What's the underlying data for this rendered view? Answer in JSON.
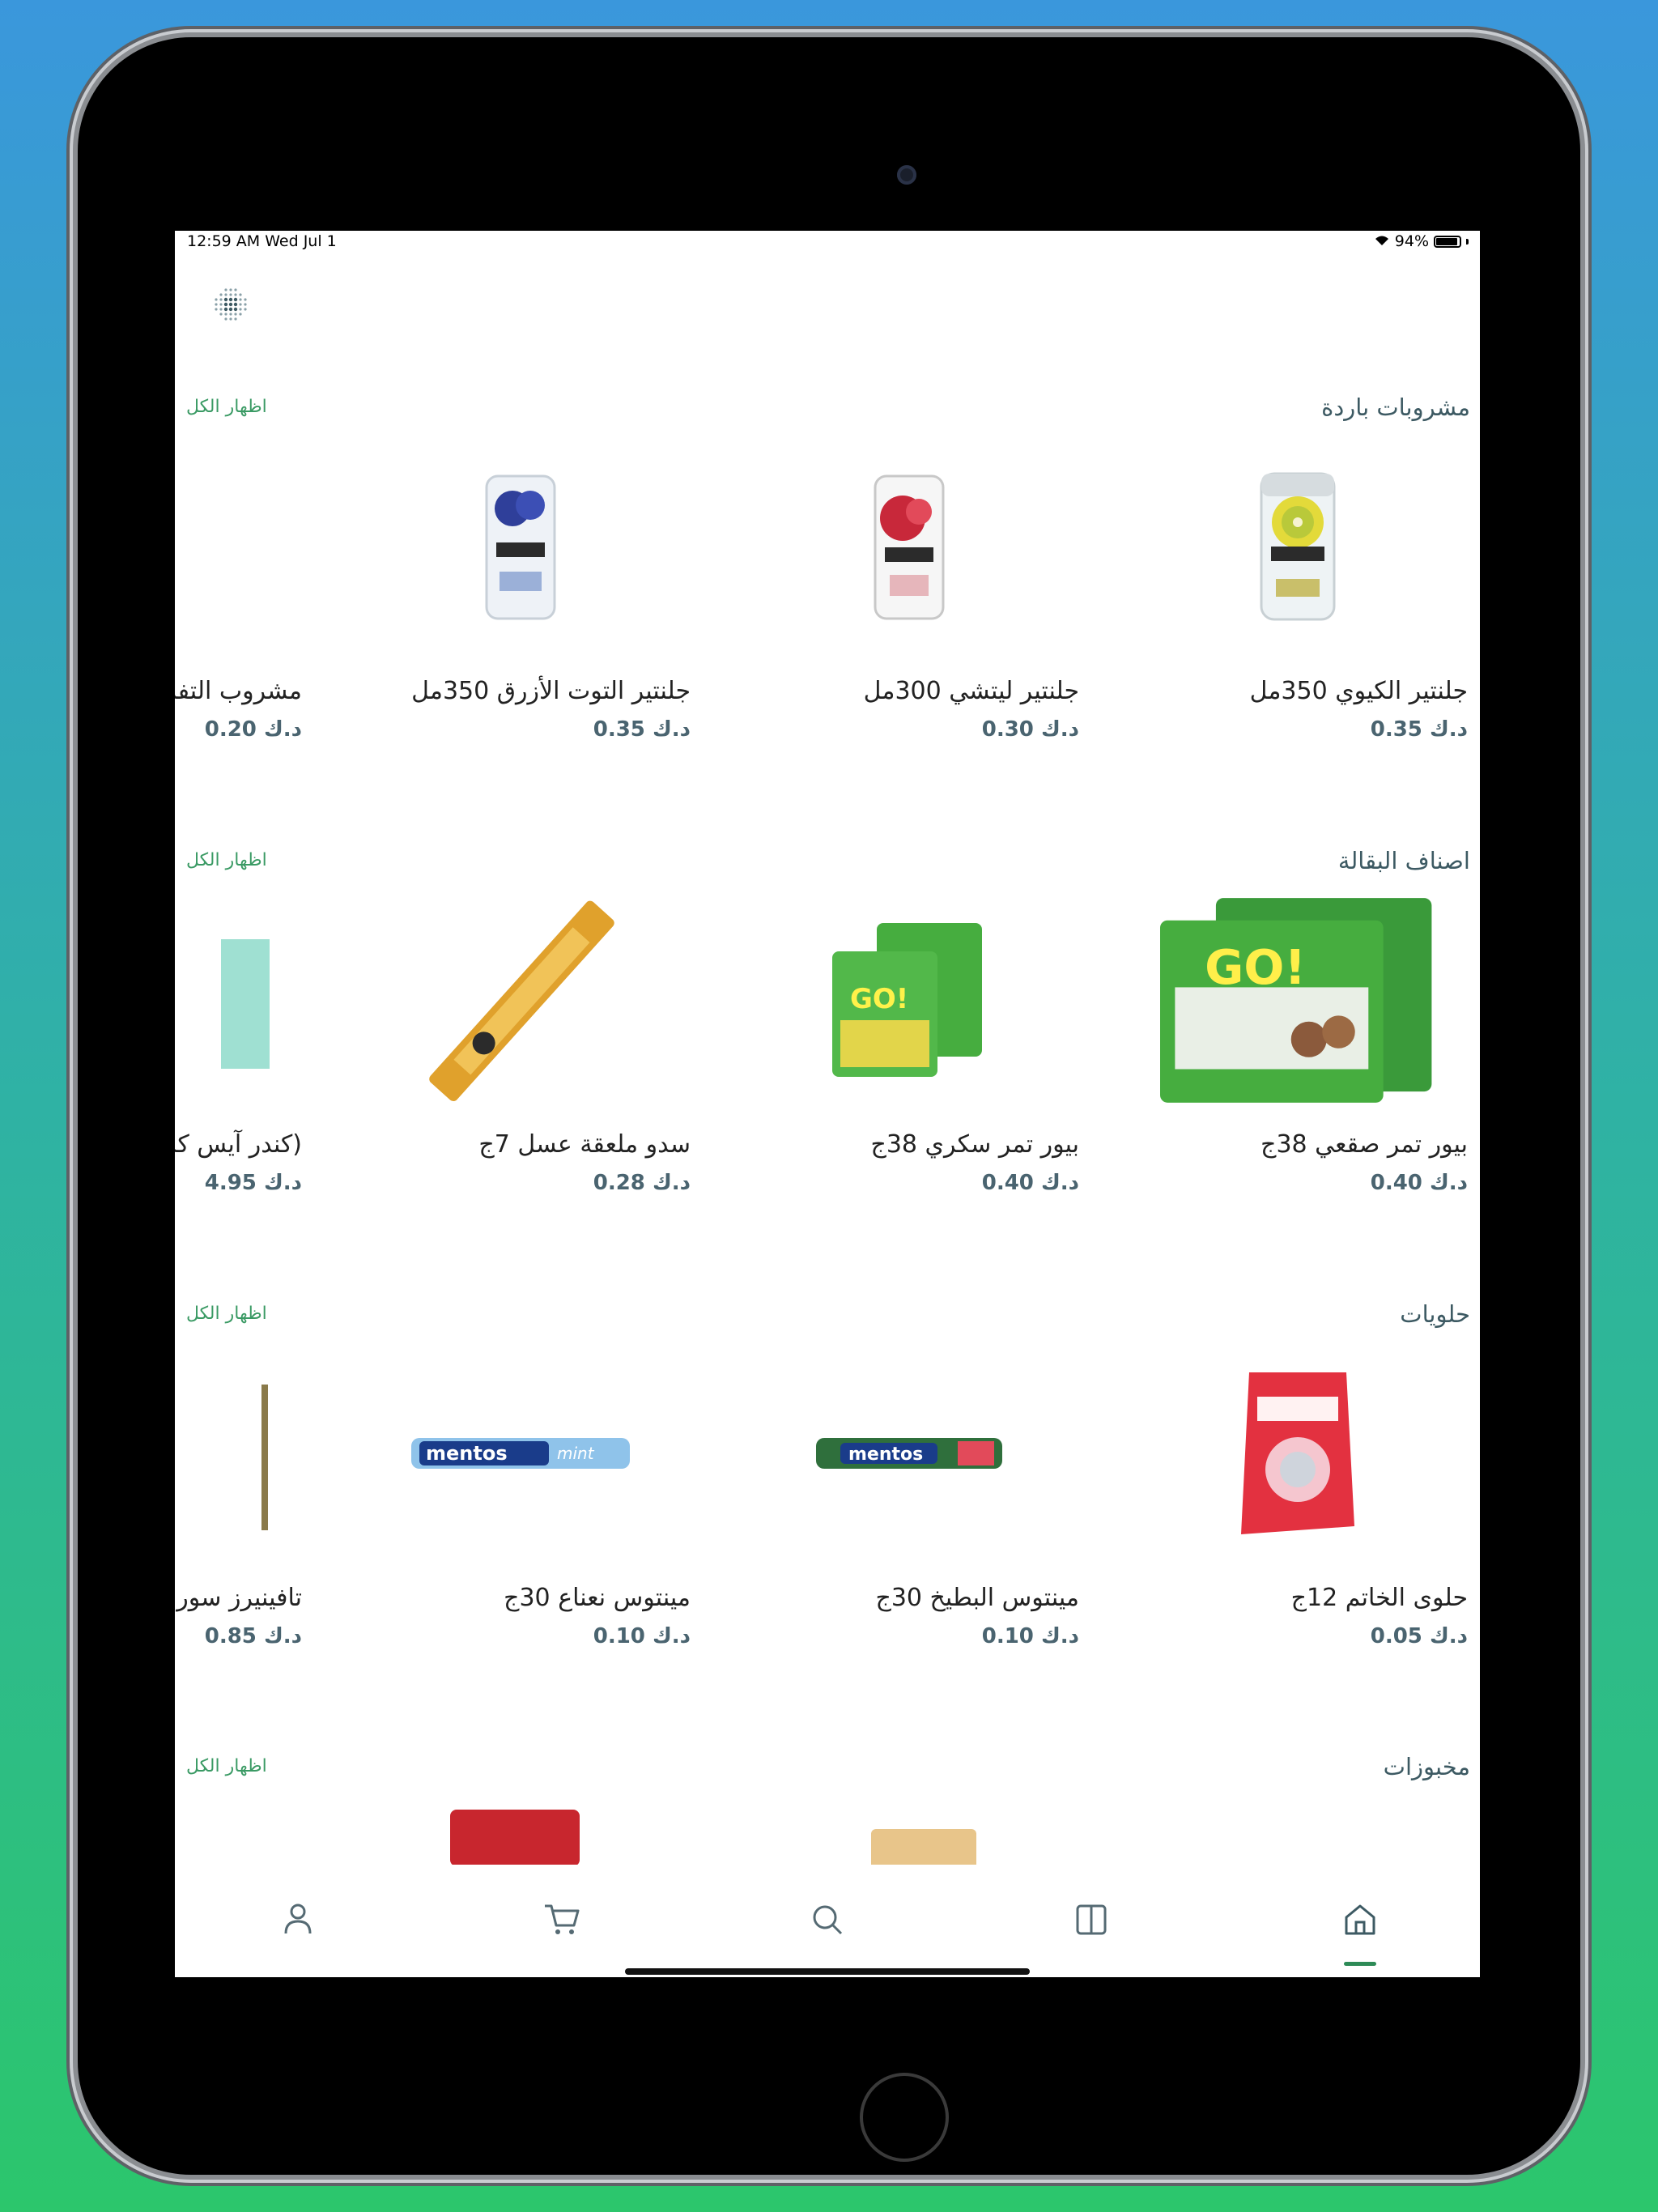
{
  "status_bar": {
    "time": "12:59 AM   Wed Jul 1",
    "battery": "94%",
    "battery_level": 0.94
  },
  "sections": [
    {
      "title": "مشروبات باردة",
      "show_all": "اظهار الكل",
      "products": [
        {
          "name": "جلنتير الكيوي 350مل",
          "price": "د.ك 0.35",
          "image": "kiwi-can"
        },
        {
          "name": "جلنتير ليتشي 300مل",
          "price": "د.ك 0.30",
          "image": "lychee-can"
        },
        {
          "name": "جلنتير التوت الأزرق 350مل",
          "price": "د.ك 0.35",
          "image": "blueberry-can"
        },
        {
          "name": "مشروب التفاح",
          "price": "د.ك 0.20",
          "image": "apple-drink"
        }
      ]
    },
    {
      "title": "اصناف البقالة",
      "show_all": "اظهار الكل",
      "products": [
        {
          "name": "بيور تمر صقعي 38ج",
          "price": "د.ك 0.40",
          "image": "go-smart-pouch"
        },
        {
          "name": "بيور تمر سكري 38ج",
          "price": "د.ك 0.40",
          "image": "go-smart-pouch-small"
        },
        {
          "name": "سدو ملعقة عسل 7ج",
          "price": "د.ك 0.28",
          "image": "honey-stick"
        },
        {
          "name": "(كندر آيس كري",
          "price": "د.ك 4.95",
          "image": "kinder-box"
        }
      ]
    },
    {
      "title": "حلويات",
      "show_all": "اظهار الكل",
      "products": [
        {
          "name": "حلوى الخاتم 12ج",
          "price": "د.ك 0.05",
          "image": "ring-candy"
        },
        {
          "name": "مينتوس البطيخ 30ج",
          "price": "د.ك 0.10",
          "image": "mentos-watermelon"
        },
        {
          "name": "مينتوس نعناع 30ج",
          "price": "د.ك 0.10",
          "image": "mentos-mint"
        },
        {
          "name": "تافينيرز سور ا",
          "price": "د.ك 0.85",
          "image": "candy-partial"
        }
      ]
    },
    {
      "title": "مخبوزات",
      "show_all": "اظهار الكل",
      "products": []
    }
  ],
  "tab_bar": {
    "tabs": [
      "profile-icon",
      "cart-icon",
      "search-icon",
      "categories-icon",
      "home-icon"
    ],
    "active": "home-icon"
  },
  "colors": {
    "accent": "#2e8b57",
    "title": "#3d5a63",
    "price": "#4a6470"
  }
}
